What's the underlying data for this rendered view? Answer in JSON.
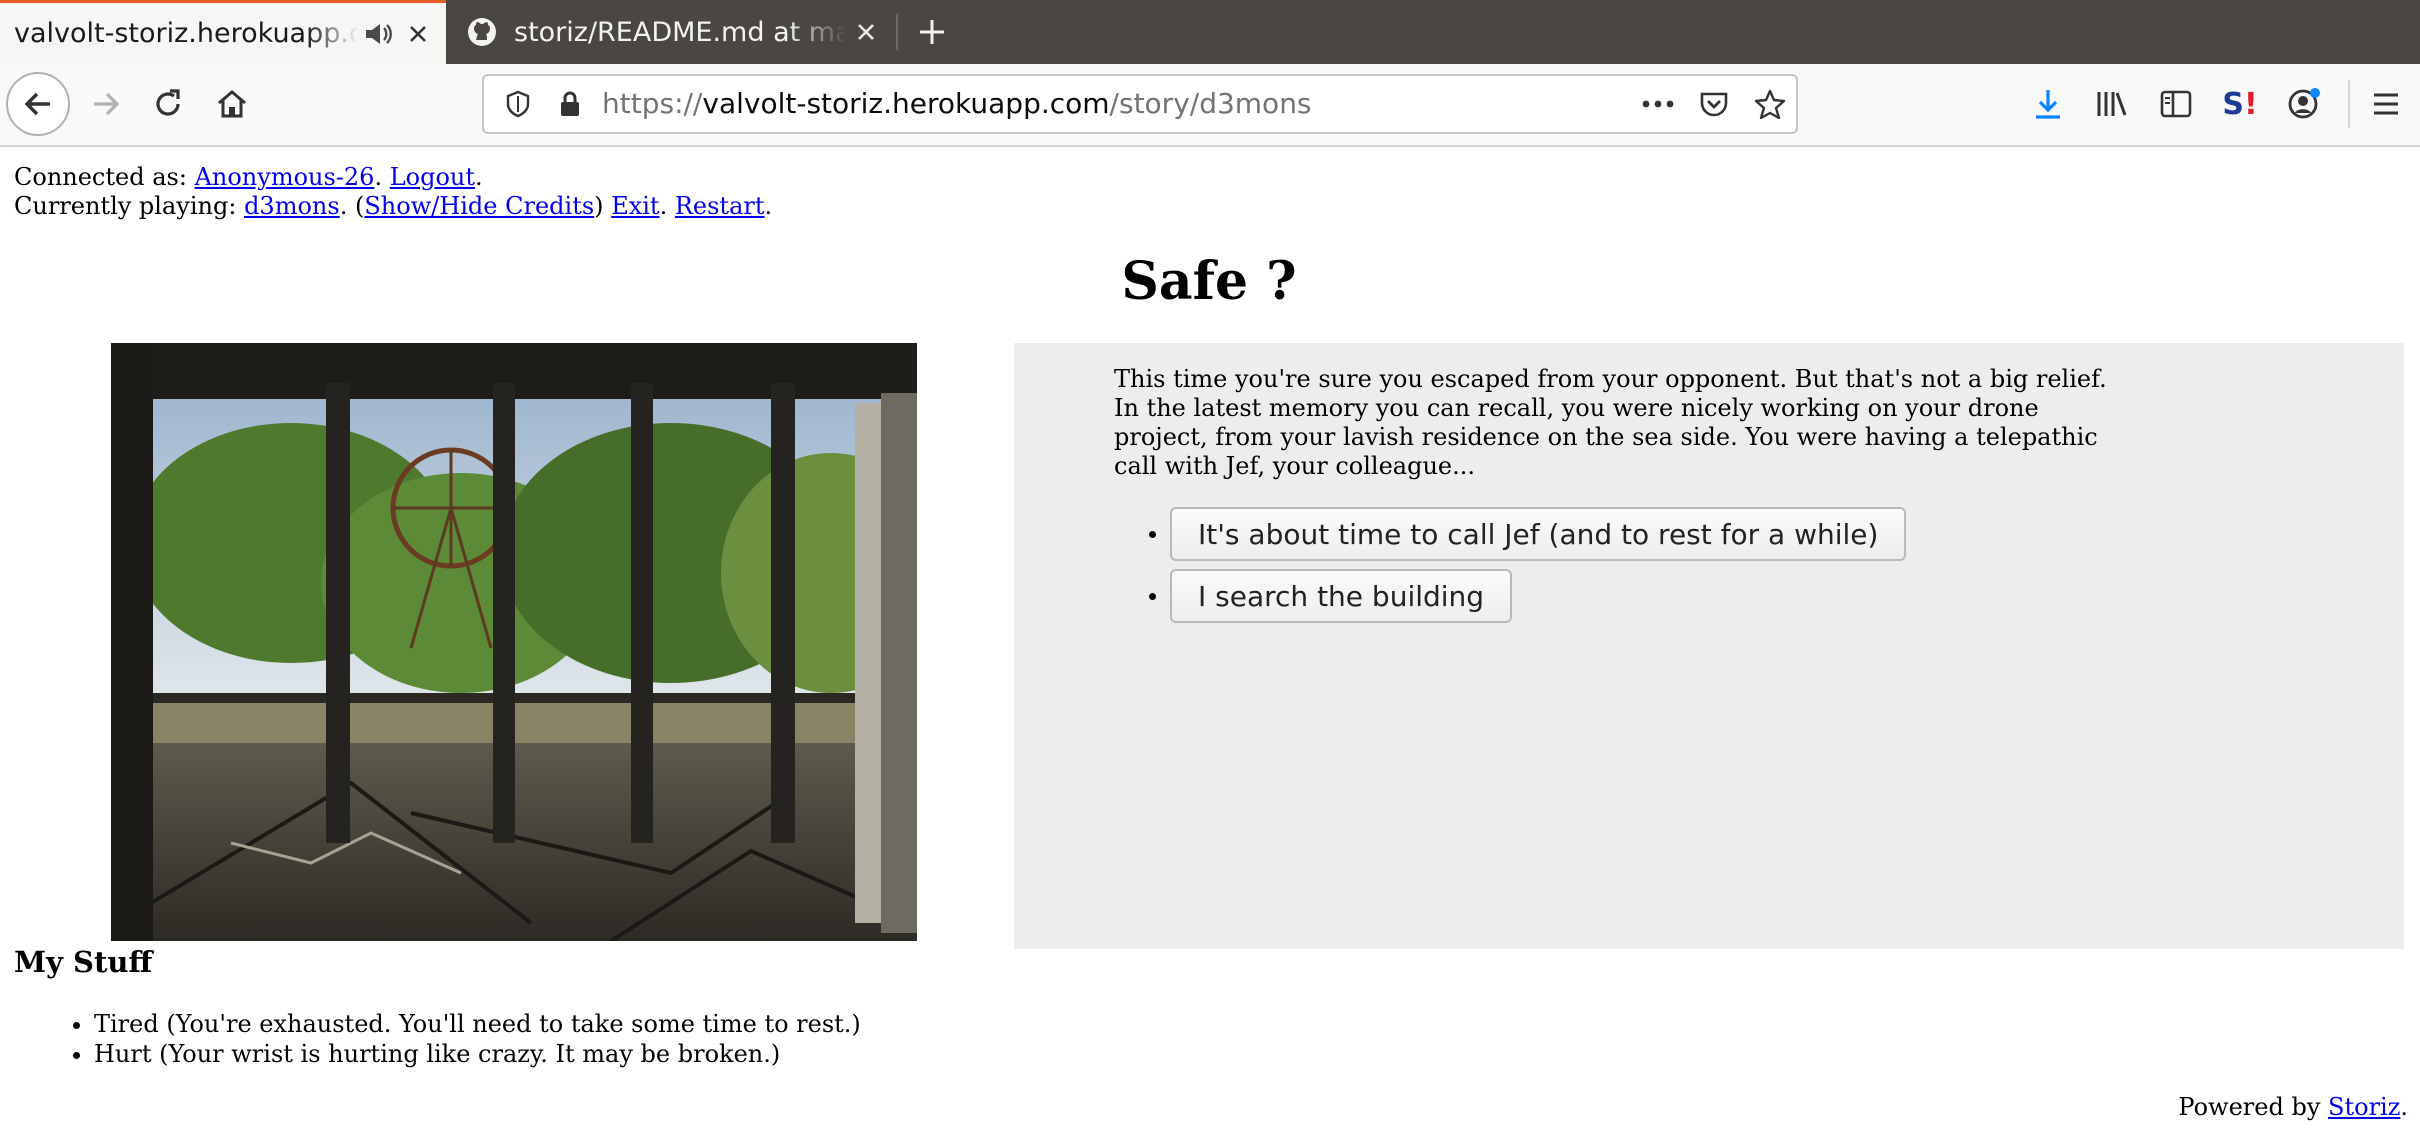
{
  "browser": {
    "tabs": [
      {
        "title": "valvolt-storiz.herokuapp.com",
        "active": true,
        "audio_icon": "speaker-icon"
      },
      {
        "title": "storiz/README.md at master",
        "active": false,
        "favicon": "github-icon"
      }
    ],
    "url": {
      "scheme": "https://",
      "host": "valvolt-storiz.herokuapp.com",
      "path": "/story/d3mons"
    },
    "accent_color": "#e65b26",
    "toolbar_icons": [
      "back-icon",
      "forward-icon",
      "reload-icon",
      "home-icon",
      "shield-icon",
      "lock-icon",
      "more-icon",
      "pocket-icon",
      "star-icon",
      "download-icon",
      "library-icon",
      "sidebar-icon",
      "extension-icon",
      "account-icon",
      "menu-icon"
    ]
  },
  "page": {
    "connected_prefix": "Connected as:",
    "user": "Anonymous-26",
    "dot": ".",
    "logout": "Logout",
    "playing_prefix": "Currently playing:",
    "story": "d3mons",
    "credits_open": "(",
    "credits": "Show/Hide Credits",
    "credits_close": ")",
    "exit": "Exit",
    "restart": "Restart",
    "title": "Safe ?",
    "text": "This time you're sure you escaped from your opponent. But that's not a big relief. In the latest memory you can recall, you were nicely working on your drone project, from your lavish residence on the sea side. You were having a telepathic call with Jef, your colleague...",
    "choices": [
      "It's about time to call Jef (and to rest for a while)",
      "I search the building"
    ],
    "stuff_title": "My Stuff",
    "stuff": [
      "Tired (You're exhausted. You'll need to take some time to rest.)",
      "Hurt (Your wrist is hurting like crazy. It may be broken.)"
    ],
    "footer_prefix": "Powered by",
    "footer_link": "Storiz"
  }
}
